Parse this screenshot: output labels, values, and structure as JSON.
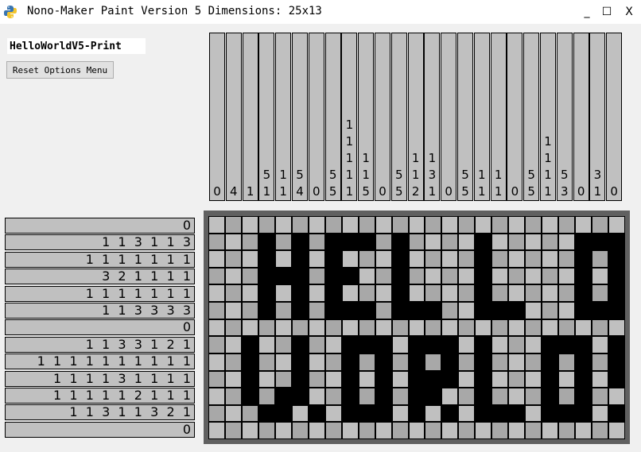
{
  "window": {
    "title": "Nono-Maker Paint Version 5 Dimensions: 25x13",
    "minimize_glyph": "_",
    "maximize_glyph": "☐",
    "close_glyph": "X"
  },
  "controls": {
    "name_value": "HelloWorldV5-Print",
    "reset_label": "Reset Options Menu"
  },
  "column_clues": [
    [
      "0"
    ],
    [
      "4"
    ],
    [
      "1"
    ],
    [
      "5",
      "1"
    ],
    [
      "1",
      "1"
    ],
    [
      "5",
      "4"
    ],
    [
      "0"
    ],
    [
      "5",
      "5"
    ],
    [
      "1",
      "1",
      "1",
      "1",
      "1"
    ],
    [
      "1",
      "1",
      "5"
    ],
    [
      "0"
    ],
    [
      "5",
      "5"
    ],
    [
      "1",
      "1",
      "2"
    ],
    [
      "1",
      "3",
      "1"
    ],
    [
      "0"
    ],
    [
      "5",
      "5"
    ],
    [
      "1",
      "1"
    ],
    [
      "1",
      "1"
    ],
    [
      "0"
    ],
    [
      "5",
      "5"
    ],
    [
      "1",
      "1",
      "1",
      "1"
    ],
    [
      "5",
      "3"
    ],
    [
      "0"
    ],
    [
      "3",
      "1"
    ],
    [
      "0"
    ]
  ],
  "row_clues": [
    "0",
    "1 1 3 1 1 3",
    "1 1 1 1 1 1 1",
    "3 2 1 1 1 1",
    "1 1 1 1 1 1 1",
    "1 1 3 3 3 3",
    "0",
    "1 1 3 3 1 2 1",
    "1 1 1 1 1 1 1 1 1 1",
    "1 1 1 1 3 1 1 1 1",
    "1 1 1 1 1 2 1 1 1",
    "1 1 3 1 1 3 2 1",
    "0"
  ],
  "grid": {
    "rows": 13,
    "cols": 25,
    "cells": [
      "0000000000000000000000000",
      "0001010111010000100000111",
      "0001010100010000100000101",
      "0001110110010000100000101",
      "0001010100010000100000101",
      "0001010111011100111000111",
      "0000000000000000000000000",
      "0010010011101110100011101",
      "0010010010101010100010101",
      "0010010010101110100010101",
      "0010110010101100100010100",
      "0001101011101010111011101",
      "0000000000000000000000000"
    ]
  },
  "colors": {
    "cell_empty": "#c0c0c0",
    "cell_alt": "#a8a8a8",
    "cell_filled": "#000000",
    "frame": "#606060"
  }
}
